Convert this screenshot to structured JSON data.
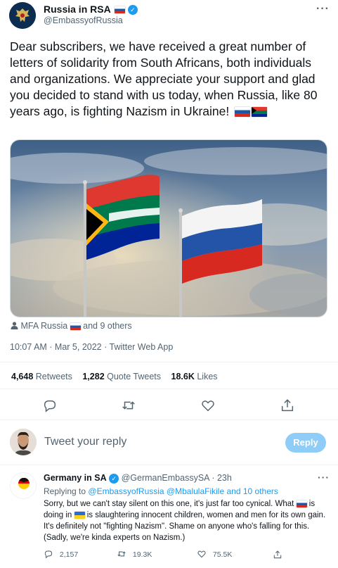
{
  "tweet": {
    "author_name": "Russia in RSA",
    "author_handle": "@EmbassyofRussia",
    "text": "Dear subscribers, we have received a great number of letters of solidarity from South Africans, both individuals and organizations. We appreciate your support and glad you decided to stand with us today, when Russia, like 80 years ago, is fighting Nazism in Ukraine!",
    "tagged_prefix": "MFA Russia",
    "tagged_suffix": "and 9 others",
    "timestamp": "10:07 AM · Mar 5, 2022 · Twitter Web App",
    "stats": [
      {
        "num": "4,648",
        "label": "Retweets"
      },
      {
        "num": "1,282",
        "label": "Quote Tweets"
      },
      {
        "num": "18.6K",
        "label": "Likes"
      }
    ]
  },
  "reply_box": {
    "placeholder": "Tweet your reply",
    "button_label": "Reply"
  },
  "reply": {
    "author_name": "Germany in SA",
    "author_handle": "@GermanEmbassySA",
    "age": "· 23h",
    "replying_to_prefix": "Replying to",
    "replying_to_mentions": "@EmbassyofRussia @MbalulaFikile and 10 others",
    "text_1": "Sorry, but we can't stay silent on this one, it's just far too cynical. What",
    "text_2": "is doing in",
    "text_3": "is slaughtering innocent children, women and men for its own gain. It's definitely not \"fighting Nazism\". Shame on anyone who's falling for this. (Sadly, we're kinda experts on Nazism.)",
    "counts": {
      "replies": "2,157",
      "retweets": "19.3K",
      "likes": "75.5K"
    }
  },
  "colors": {
    "accent": "#1d9bf0",
    "muted": "#536471",
    "reply_button_disabled": "#8ecdf8"
  },
  "icons": [
    "verified-badge-icon",
    "more-icon",
    "person-icon",
    "reply-icon",
    "retweet-icon",
    "like-icon",
    "share-icon"
  ]
}
